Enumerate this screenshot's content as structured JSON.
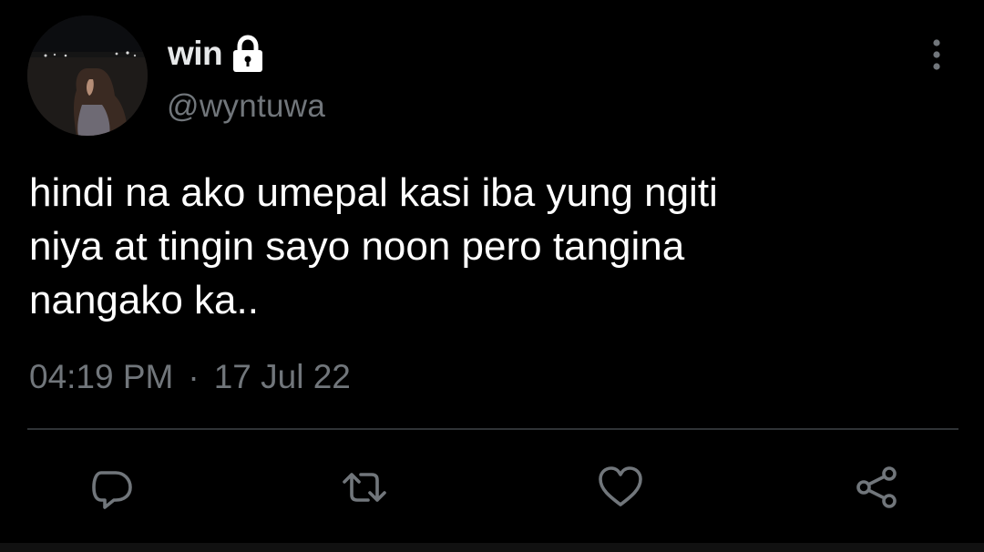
{
  "tweet": {
    "display_name": "win",
    "handle": "@wyntuwa",
    "text": "hindi na ako umepal kasi iba yung ngiti\nniya at tingin sayo noon pero tangina\nnangako ka..",
    "time": "04:19 PM",
    "separator": "·",
    "date": "17 Jul 22"
  },
  "icons": {
    "lock": "lock-icon",
    "more": "more-vertical-icon",
    "reply": "reply-icon",
    "retweet": "retweet-icon",
    "like": "heart-icon",
    "share": "share-icon"
  },
  "colors": {
    "background": "#000000",
    "text_primary": "#ffffff",
    "text_secondary": "#71767b",
    "divider": "#2f3336"
  }
}
